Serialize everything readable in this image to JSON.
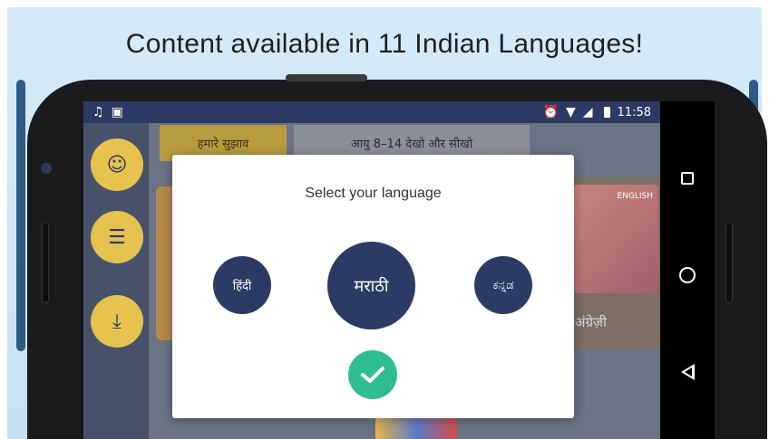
{
  "banner": {
    "headline": "Content available in 11 Indian Languages!"
  },
  "statusbar": {
    "left_icons": [
      "music-icon",
      "image-icon"
    ],
    "right_icons": [
      "alarm-icon",
      "wifi-icon",
      "signal-icon",
      "battery-icon"
    ],
    "time": "11:58"
  },
  "app": {
    "rail": [
      {
        "name": "home-rail-button",
        "icon": "smile-box-icon"
      },
      {
        "name": "library-rail-button",
        "icon": "books-icon"
      },
      {
        "name": "download-rail-button",
        "icon": "download-icon"
      }
    ],
    "chips": {
      "suggestions": "हमारे सुझाव",
      "age_watch_learn": "आयु 8–14 देखो और सीखो"
    },
    "book_right_label": "अंग्रेज़ी",
    "book_right_cover_text": "ENGLISH"
  },
  "dialog": {
    "title": "Select your language",
    "options": [
      {
        "label": "हिंदी",
        "selected": false
      },
      {
        "label": "मराठी",
        "selected": true
      },
      {
        "label": "ಕನ್ನಡ",
        "selected": false
      }
    ],
    "confirm_icon": "checkmark-icon"
  },
  "navbar": {
    "buttons": [
      "recents-button",
      "home-button",
      "back-button"
    ]
  },
  "colors": {
    "banner_bg": "#c4e2f3",
    "navy": "#2b3b63",
    "accent_yellow": "#e6c24f",
    "confirm_green": "#2fbe93"
  }
}
